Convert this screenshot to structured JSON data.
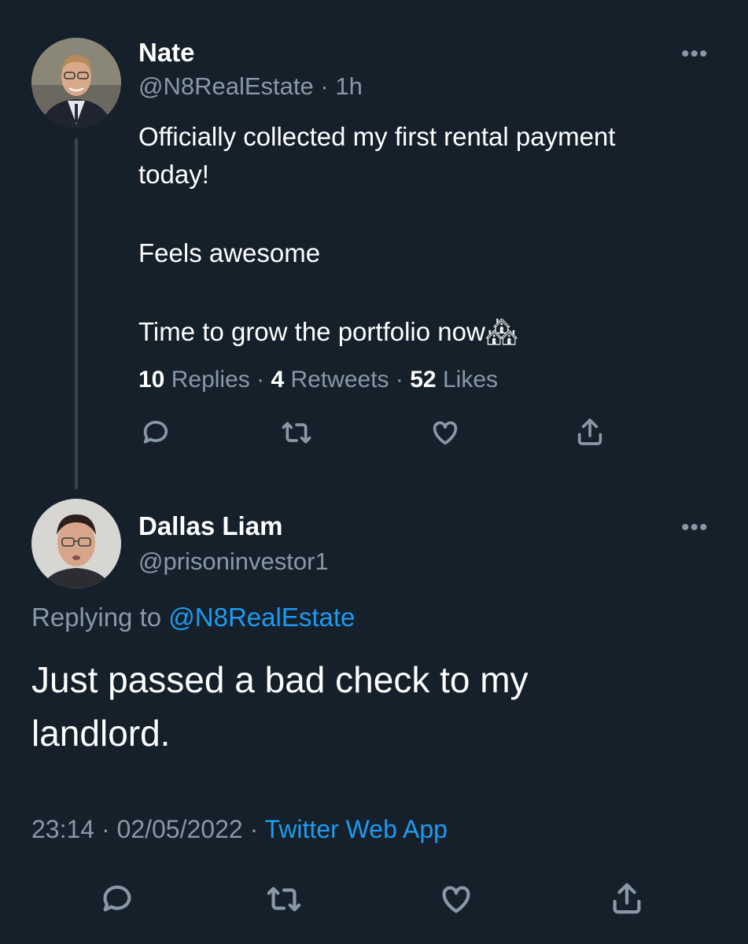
{
  "original_tweet": {
    "name": "Nate",
    "handle": "@N8RealEstate",
    "dot": "·",
    "time": "1h",
    "text_line1": "Officially collected my first rental payment",
    "text_line2": "today!",
    "text_line3": "Feels awesome",
    "text_line4": "Time to grow the portfolio now",
    "emoji": "🏘",
    "stats": {
      "replies_count": "10",
      "replies_label": "Replies",
      "retweets_count": "4",
      "retweets_label": "Retweets",
      "likes_count": "52",
      "likes_label": "Likes",
      "sep": "·"
    }
  },
  "reply_tweet": {
    "name": "Dallas Liam",
    "handle": "@prisoninvestor1",
    "replying_label": "Replying to",
    "replying_handle": "@N8RealEstate",
    "text_line1": "Just passed a bad check to my",
    "text_line2": "landlord.",
    "time": "23:14",
    "date": "02/05/2022",
    "sep": "·",
    "source": "Twitter Web App"
  },
  "more_glyph": "•••",
  "colors": {
    "background": "#15202b",
    "text": "#ffffff",
    "muted": "#8899a6",
    "link": "#1d9bf0",
    "thread_line": "#38444d"
  },
  "icons": [
    "reply-icon",
    "retweet-icon",
    "like-icon",
    "share-icon",
    "more-icon"
  ]
}
